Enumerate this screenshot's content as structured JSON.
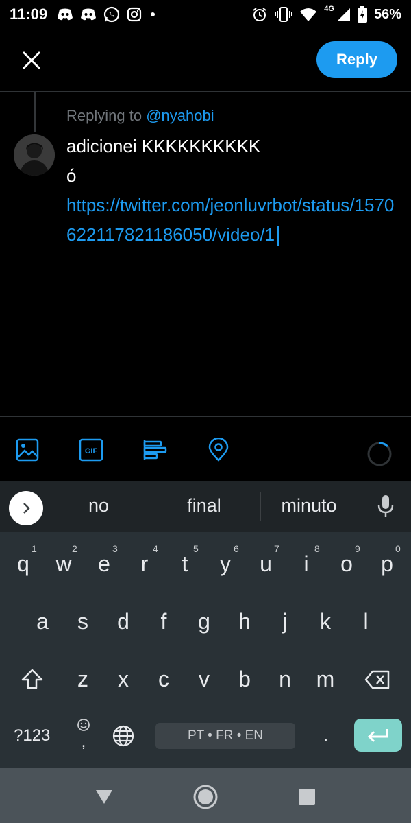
{
  "status_bar": {
    "time": "11:09",
    "network_label": "4G",
    "battery_percent": "56%",
    "left_icons": [
      "discord-icon",
      "discord-icon",
      "whatsapp-icon",
      "instagram-icon",
      "dot-icon"
    ],
    "right_icons": [
      "alarm-icon",
      "vibrate-icon",
      "wifi-icon",
      "signal-icon",
      "battery-charging-icon"
    ]
  },
  "header": {
    "close_icon": "close-icon",
    "reply_label": "Reply"
  },
  "compose": {
    "replying_prefix": "Replying to",
    "replying_handle": "@nyahobi",
    "line1": "adicionei KKKKKKKKKK",
    "line2": "ó",
    "link": "https://twitter.com/jeonluvrbot/status/1570622117821186050/video/1"
  },
  "toolbar": {
    "icons": [
      "image-icon",
      "gif-icon",
      "poll-icon",
      "location-icon"
    ],
    "accent": "#1d9bf0"
  },
  "suggestions": {
    "words": [
      "no",
      "final",
      "minuto"
    ]
  },
  "keyboard": {
    "row1": [
      "q",
      "w",
      "e",
      "r",
      "t",
      "y",
      "u",
      "i",
      "o",
      "p"
    ],
    "row1_hints": [
      "1",
      "2",
      "3",
      "4",
      "5",
      "6",
      "7",
      "8",
      "9",
      "0"
    ],
    "row2": [
      "a",
      "s",
      "d",
      "f",
      "g",
      "h",
      "j",
      "k",
      "l"
    ],
    "row3": [
      "z",
      "x",
      "c",
      "v",
      "b",
      "n",
      "m"
    ],
    "symbols_label": "?123",
    "comma_label": ",",
    "period_label": ".",
    "space_label": "PT • FR • EN",
    "enter_color": "#7fd3ca"
  },
  "navbar": {
    "icons": [
      "back-icon",
      "home-icon",
      "recents-icon"
    ]
  }
}
